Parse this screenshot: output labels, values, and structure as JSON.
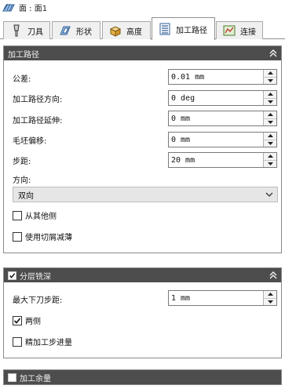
{
  "title": {
    "text": "面 : 面1",
    "icon": "face-icon"
  },
  "tabs": [
    {
      "label": "刀具",
      "icon": "tool-icon",
      "active": false
    },
    {
      "label": "形状",
      "icon": "shape-icon",
      "active": false
    },
    {
      "label": "高度",
      "icon": "height-icon",
      "active": false
    },
    {
      "label": "加工路径",
      "icon": "toolpath-icon",
      "active": true
    },
    {
      "label": "连接",
      "icon": "linking-icon",
      "active": false
    }
  ],
  "passes": {
    "header": "加工路径",
    "tolerance": {
      "label": "公差:",
      "value": "0.01 mm"
    },
    "direction": {
      "label": "加工路径方向:",
      "value": "0 deg"
    },
    "extension": {
      "label": "加工路径延伸:",
      "value": "0 mm"
    },
    "stock_offset": {
      "label": "毛坯偏移:",
      "value": "0 mm"
    },
    "stepover": {
      "label": "步距:",
      "value": "20 mm"
    },
    "cut_direction": {
      "label": "方向:",
      "selected": "双向"
    },
    "other_side": {
      "label": "从其他侧",
      "checked": false
    },
    "chip_thinning": {
      "label": "使用切屑减薄",
      "checked": false
    }
  },
  "multiple_depths": {
    "header": "分层铣深",
    "checked": true,
    "max_stepdown": {
      "label": "最大下刀步距:",
      "value": "1 mm"
    },
    "both_ways": {
      "label": "两侧",
      "checked": true
    },
    "finishing_stepdown": {
      "label": "精加工步进量",
      "checked": false
    }
  },
  "stock_to_leave": {
    "header": "加工余量",
    "checked": false
  },
  "colors": {
    "header_bg": "#4d4d4d",
    "header_text": "#f2f2f2",
    "accent_blue": "#3a6fb0"
  }
}
